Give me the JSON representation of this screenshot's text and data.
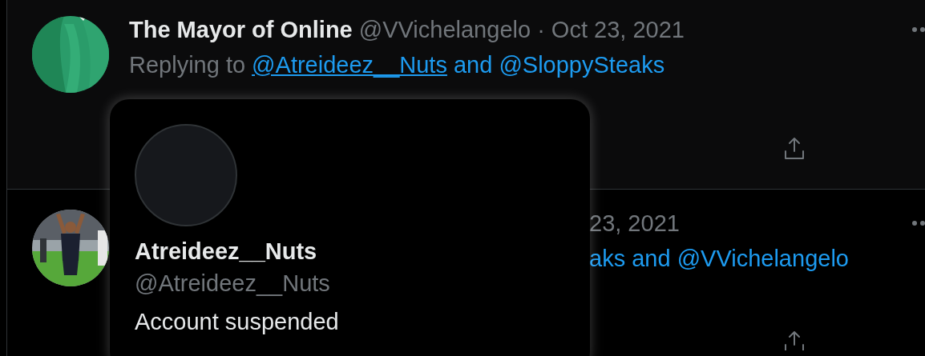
{
  "tweets": [
    {
      "highlighted": true,
      "display_name": "The Mayor of Online",
      "meta": "@VVichelangelo · Oct 23, 2021",
      "replying": {
        "prefix": "Replying to",
        "mentions": [
          {
            "text": "@Atreideez__Nuts",
            "underlined": true
          },
          {
            "text": "and @SloppySteaks",
            "underlined": false
          }
        ]
      }
    },
    {
      "highlighted": false,
      "meta": "23, 2021",
      "replying": {
        "mentions": [
          {
            "text": "aks and @VVichelangelo",
            "underlined": false
          }
        ]
      }
    }
  ],
  "hover_card": {
    "display_name": "Atreideez__Nuts",
    "handle": "@Atreideez__Nuts",
    "status": "Account suspended"
  }
}
